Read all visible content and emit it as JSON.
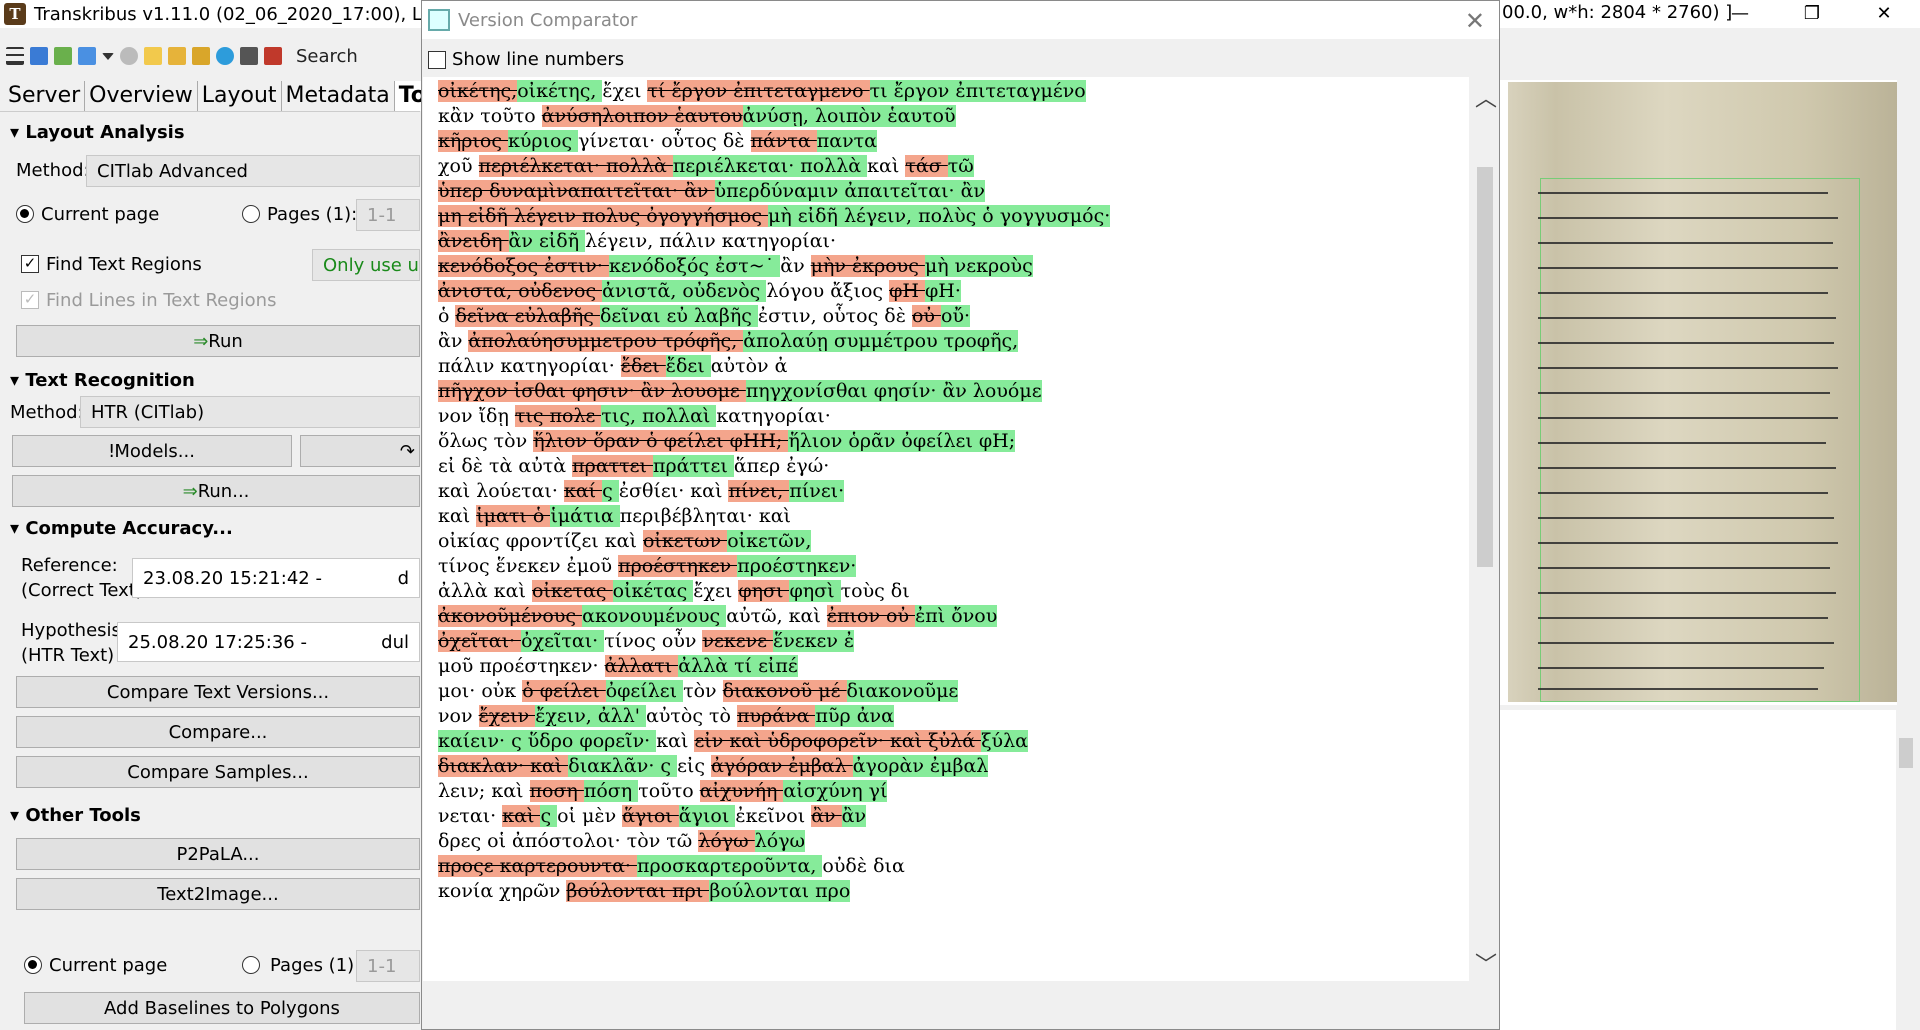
{
  "app": {
    "title": "Transkribus v1.11.0 (02_06_2020_17:00), Loaded",
    "title_tail": "00.0, w*h: 2804 * 2760) ]",
    "window_controls": [
      "—",
      "❐",
      "✕"
    ]
  },
  "toolbar": {
    "search_placeholder": "Search"
  },
  "left": {
    "tabs": [
      "Server",
      "Overview",
      "Layout",
      "Metadata",
      "Tools"
    ],
    "layout_analysis": {
      "title": "Layout Analysis",
      "method_label": "Method:",
      "method_value": "CITlab Advanced",
      "current_page": "Current page",
      "pages_label": "Pages (1):",
      "pages_value": "1-1",
      "find_text_regions": "Find Text Regions",
      "only_use": "Only use uns",
      "find_lines": "Find Lines in Text Regions",
      "run": "Run"
    },
    "text_recognition": {
      "title": "Text Recognition",
      "method_label": "Method:",
      "method_value": "HTR (CITlab)",
      "models": "Models...",
      "run": "Run..."
    },
    "compute_accuracy": {
      "title": "Compute Accuracy...",
      "reference_label": "Reference:",
      "reference_sub": "(Correct Text)",
      "reference_value": "23.08.20 15:21:42 -",
      "reference_tail": "d",
      "hypothesis_label": "Hypothesis:",
      "hypothesis_sub": "(HTR Text)",
      "hypothesis_value": "25.08.20 17:25:36 -",
      "hypothesis_tail": "dul",
      "compare_versions": "Compare Text Versions...",
      "compare": "Compare...",
      "compare_samples": "Compare Samples..."
    },
    "other_tools": {
      "title": "Other Tools",
      "p2pala": "P2PaLA...",
      "text2image": "Text2Image...",
      "current_page": "Current page",
      "pages_label": "Pages (1):",
      "pages_value": "1-1",
      "add_baselines": "Add Baselines to Polygons"
    }
  },
  "dialog": {
    "title": "Version Comparator",
    "show_line_numbers": "Show line numbers",
    "lines": [
      [
        [
          "d",
          "οἰκέτης,"
        ],
        [
          "i",
          "οἰκέτης, "
        ],
        [
          "n",
          "ἔχει "
        ],
        [
          "d",
          "τί ἔργον ἐπιτεταγμενο "
        ],
        [
          "i",
          "τι ἔργον ἐπιτεταγμένο"
        ]
      ],
      [
        [
          "n",
          "κἂν τοῦτο "
        ],
        [
          "d",
          "ἀνύσηλοιπον ἑαυτου"
        ],
        [
          "i",
          "ἀνύσῃ, λοιπὸν ἑαυτοῦ"
        ]
      ],
      [
        [
          "d",
          "κῆριος "
        ],
        [
          "i",
          "κύριος "
        ],
        [
          "n",
          "γίνεται· οὗτος δὲ "
        ],
        [
          "d",
          "πάντα "
        ],
        [
          "i",
          "παντα"
        ]
      ],
      [
        [
          "n",
          "χοῦ "
        ],
        [
          "d",
          "περιέλκεται· πολλὰ "
        ],
        [
          "i",
          "περιέλκεται· πολλὰ "
        ],
        [
          "n",
          "καὶ "
        ],
        [
          "d",
          "τάσ "
        ],
        [
          "i",
          "τῶ"
        ]
      ],
      [
        [
          "d",
          "ὑπερ δυναμὶναπαιτεῖται· ἂν "
        ],
        [
          "i",
          "ὑπερδύναμιν ἀπαιτεῖται· ἂν"
        ]
      ],
      [
        [
          "d",
          "μη εἰδῆ λέγειν πολυς ὀγογγήσμος "
        ],
        [
          "i",
          "μὴ εἰδῆ λέγειν, πολὺς ὁ γογγυσμός·"
        ]
      ],
      [
        [
          "d",
          "ἂνειδη "
        ],
        [
          "i",
          "ἂν εἰδῆ "
        ],
        [
          "n",
          "λέγειν, πάλιν κατηγορίαι·"
        ]
      ],
      [
        [
          "d",
          "κενόδοξος ἐστιν· "
        ],
        [
          "i",
          "κενόδοξός ἐστ~˙ "
        ],
        [
          "n",
          "ἂν "
        ],
        [
          "d",
          "μὴν ἐκρους "
        ],
        [
          "i",
          "μὴ νεκροὺς"
        ]
      ],
      [
        [
          "d",
          "ἀνιστα, οὐδενος "
        ],
        [
          "i",
          "ἀνιστᾶ, οὐδενὸς "
        ],
        [
          "n",
          "λόγου ἄξιος "
        ],
        [
          "d",
          "φH "
        ],
        [
          "i",
          "φΗ·"
        ]
      ],
      [
        [
          "n",
          "ὁ "
        ],
        [
          "d",
          "δεῖνα εὐλαβῆς "
        ],
        [
          "i",
          "δεῖναι εὐ λαβῆς "
        ],
        [
          "n",
          "ἐστιν, οὗτος δὲ "
        ],
        [
          "d",
          "οὐ "
        ],
        [
          "i",
          "οὔ·"
        ]
      ],
      [
        [
          "n",
          "ἂν "
        ],
        [
          "d",
          "ἀπολαύησυμμετρου τρόφῆς, "
        ],
        [
          "i",
          "ἀπολαύῃ συμμέτρου τροφῆς,"
        ]
      ],
      [
        [
          "n",
          "πάλιν κατηγορίαι· "
        ],
        [
          "d",
          "ἔδει "
        ],
        [
          "i",
          "ἔδει "
        ],
        [
          "n",
          "αὐτὸν ἀ"
        ]
      ],
      [
        [
          "d",
          "πῆγχον ἰσθαι φησιν· ἂν λουομε "
        ],
        [
          "i",
          "πηγχονίσθαι φησίν· ἂν λουόμε"
        ]
      ],
      [
        [
          "n",
          "νον ἴδῃ "
        ],
        [
          "d",
          "τις πολε "
        ],
        [
          "i",
          "τις, πολλαὶ "
        ],
        [
          "n",
          "κατηγορίαι·"
        ]
      ],
      [
        [
          "n",
          "ὅλως τὸν "
        ],
        [
          "d",
          "ἥλιον ὅραν ὁ φείλει φHH; "
        ],
        [
          "i",
          "ἥλιον ὁρᾶν ὀφείλει φΗ;"
        ]
      ],
      [
        [
          "n",
          "εἰ δὲ τὰ αὐτὰ "
        ],
        [
          "d",
          "πραττει "
        ],
        [
          "i",
          "πράττει "
        ],
        [
          "n",
          "ἅπερ ἐγώ·"
        ]
      ],
      [
        [
          "n",
          "καὶ λούεται· "
        ],
        [
          "d",
          "καί "
        ],
        [
          "i",
          "ς "
        ],
        [
          "n",
          "ἐσθίει· καὶ "
        ],
        [
          "d",
          "πίνει, "
        ],
        [
          "i",
          "πίνει·"
        ]
      ],
      [
        [
          "n",
          "καὶ "
        ],
        [
          "d",
          "ἱματι ὁ "
        ],
        [
          "i",
          "ἱμάτια "
        ],
        [
          "n",
          "περιβέβληται· καὶ"
        ]
      ],
      [
        [
          "n",
          "οἰκίας φροντίζει καὶ "
        ],
        [
          "d",
          "οἰκετων "
        ],
        [
          "i",
          "οἰκετῶν,"
        ]
      ],
      [
        [
          "n",
          "τίνος ἕνεκεν ἐμοῦ "
        ],
        [
          "d",
          "προέστηκεν "
        ],
        [
          "i",
          "προέστηκεν·"
        ]
      ],
      [
        [
          "n",
          "ἀλλὰ καὶ "
        ],
        [
          "d",
          "οἰκετας "
        ],
        [
          "i",
          "οἰκέτας "
        ],
        [
          "n",
          "ἔχει "
        ],
        [
          "d",
          "φησι "
        ],
        [
          "i",
          "φησὶ "
        ],
        [
          "n",
          "τοὺς δι"
        ]
      ],
      [
        [
          "d",
          "ἀκονοῦμένους "
        ],
        [
          "i",
          "ακονουμένους "
        ],
        [
          "n",
          "αὐτῶ, καὶ "
        ],
        [
          "d",
          "ἐπιον οὐ "
        ],
        [
          "i",
          "ἐπὶ ὄνου"
        ]
      ],
      [
        [
          "d",
          "ὀχεῖται· "
        ],
        [
          "i",
          "ὀχεῖται· "
        ],
        [
          "n",
          "τίνος οὖν "
        ],
        [
          "d",
          "νεκενε "
        ],
        [
          "i",
          "ἕνεκεν ἐ"
        ]
      ],
      [
        [
          "n",
          "μοῦ προέστηκεν· "
        ],
        [
          "d",
          "ἀλλατι "
        ],
        [
          "i",
          "ἀλλὰ τί εἰπέ"
        ]
      ],
      [
        [
          "n",
          "μοι· οὐκ "
        ],
        [
          "d",
          "ὁ φείλει "
        ],
        [
          "i",
          "ὀφείλει "
        ],
        [
          "n",
          "τὸν "
        ],
        [
          "d",
          "διακονοῦ μέ "
        ],
        [
          "i",
          "διακονοῦμε"
        ]
      ],
      [
        [
          "n",
          "νον "
        ],
        [
          "d",
          "ἔχειν "
        ],
        [
          "i",
          "ἔχειν, ἀλλ' "
        ],
        [
          "n",
          "αὐτὸς τὸ "
        ],
        [
          "d",
          "πυράνα "
        ],
        [
          "i",
          "πῦρ ἀνα"
        ]
      ],
      [
        [
          "i",
          "καίειν· ς ὕδρο φορεῖν· "
        ],
        [
          "n",
          "καὶ "
        ],
        [
          "d",
          "εἰν καὶ ὑδροφορεῖν· καὶ ξὐλά "
        ],
        [
          "i",
          "ξύλα"
        ]
      ],
      [
        [
          "d",
          "διακλαν· καὶ "
        ],
        [
          "i",
          "διακλᾶν· ς "
        ],
        [
          "n",
          "εἰς "
        ],
        [
          "d",
          "ἀγόραν ἐμβαλ "
        ],
        [
          "i",
          "ἀγορὰν ἐμβαλ"
        ]
      ],
      [
        [
          "n",
          "λειν; καὶ "
        ],
        [
          "d",
          "ποση "
        ],
        [
          "i",
          "πόση "
        ],
        [
          "n",
          "τοῦτο "
        ],
        [
          "d",
          "αἰχυνήη "
        ],
        [
          "i",
          "αἰσχύνη γί"
        ]
      ],
      [
        [
          "n",
          "νεται· "
        ],
        [
          "d",
          "καὶ "
        ],
        [
          "i",
          "ς "
        ],
        [
          "n",
          "οἱ μὲν "
        ],
        [
          "d",
          "ἅγιοι "
        ],
        [
          "i",
          "ἅγιοι "
        ],
        [
          "n",
          "ἐκεῖνοι "
        ],
        [
          "d",
          "ἂν "
        ],
        [
          "i",
          "ἂν"
        ]
      ],
      [
        [
          "n",
          "δρες οἱ ἀπόστολοι· τὸν τῶ "
        ],
        [
          "d",
          "λόγω "
        ],
        [
          "i",
          "λόγω"
        ]
      ],
      [
        [
          "d",
          "προςε καρτερουντα· "
        ],
        [
          "i",
          "προσκαρτεροῦντα, "
        ],
        [
          "n",
          "οὐδὲ δια"
        ]
      ],
      [
        [
          "n",
          "κονία χηρῶν "
        ],
        [
          "d",
          "βούλονται πρι "
        ],
        [
          "i",
          "βούλονται προ"
        ]
      ]
    ]
  }
}
